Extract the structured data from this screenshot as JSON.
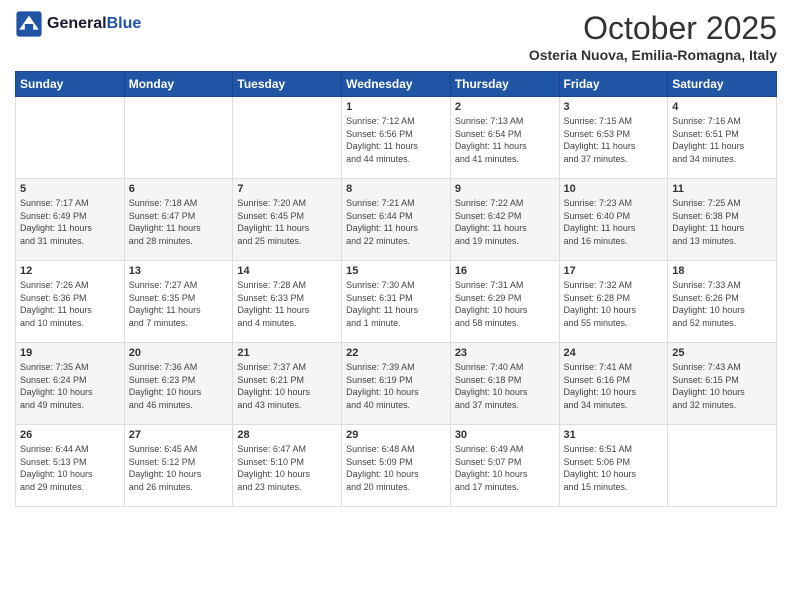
{
  "header": {
    "logo_line1": "General",
    "logo_line2": "Blue",
    "title": "October 2025",
    "subtitle": "Osteria Nuova, Emilia-Romagna, Italy"
  },
  "days_of_week": [
    "Sunday",
    "Monday",
    "Tuesday",
    "Wednesday",
    "Thursday",
    "Friday",
    "Saturday"
  ],
  "weeks": [
    [
      {
        "day": "",
        "info": ""
      },
      {
        "day": "",
        "info": ""
      },
      {
        "day": "",
        "info": ""
      },
      {
        "day": "1",
        "info": "Sunrise: 7:12 AM\nSunset: 6:56 PM\nDaylight: 11 hours\nand 44 minutes."
      },
      {
        "day": "2",
        "info": "Sunrise: 7:13 AM\nSunset: 6:54 PM\nDaylight: 11 hours\nand 41 minutes."
      },
      {
        "day": "3",
        "info": "Sunrise: 7:15 AM\nSunset: 6:53 PM\nDaylight: 11 hours\nand 37 minutes."
      },
      {
        "day": "4",
        "info": "Sunrise: 7:16 AM\nSunset: 6:51 PM\nDaylight: 11 hours\nand 34 minutes."
      }
    ],
    [
      {
        "day": "5",
        "info": "Sunrise: 7:17 AM\nSunset: 6:49 PM\nDaylight: 11 hours\nand 31 minutes."
      },
      {
        "day": "6",
        "info": "Sunrise: 7:18 AM\nSunset: 6:47 PM\nDaylight: 11 hours\nand 28 minutes."
      },
      {
        "day": "7",
        "info": "Sunrise: 7:20 AM\nSunset: 6:45 PM\nDaylight: 11 hours\nand 25 minutes."
      },
      {
        "day": "8",
        "info": "Sunrise: 7:21 AM\nSunset: 6:44 PM\nDaylight: 11 hours\nand 22 minutes."
      },
      {
        "day": "9",
        "info": "Sunrise: 7:22 AM\nSunset: 6:42 PM\nDaylight: 11 hours\nand 19 minutes."
      },
      {
        "day": "10",
        "info": "Sunrise: 7:23 AM\nSunset: 6:40 PM\nDaylight: 11 hours\nand 16 minutes."
      },
      {
        "day": "11",
        "info": "Sunrise: 7:25 AM\nSunset: 6:38 PM\nDaylight: 11 hours\nand 13 minutes."
      }
    ],
    [
      {
        "day": "12",
        "info": "Sunrise: 7:26 AM\nSunset: 6:36 PM\nDaylight: 11 hours\nand 10 minutes."
      },
      {
        "day": "13",
        "info": "Sunrise: 7:27 AM\nSunset: 6:35 PM\nDaylight: 11 hours\nand 7 minutes."
      },
      {
        "day": "14",
        "info": "Sunrise: 7:28 AM\nSunset: 6:33 PM\nDaylight: 11 hours\nand 4 minutes."
      },
      {
        "day": "15",
        "info": "Sunrise: 7:30 AM\nSunset: 6:31 PM\nDaylight: 11 hours\nand 1 minute."
      },
      {
        "day": "16",
        "info": "Sunrise: 7:31 AM\nSunset: 6:29 PM\nDaylight: 10 hours\nand 58 minutes."
      },
      {
        "day": "17",
        "info": "Sunrise: 7:32 AM\nSunset: 6:28 PM\nDaylight: 10 hours\nand 55 minutes."
      },
      {
        "day": "18",
        "info": "Sunrise: 7:33 AM\nSunset: 6:26 PM\nDaylight: 10 hours\nand 52 minutes."
      }
    ],
    [
      {
        "day": "19",
        "info": "Sunrise: 7:35 AM\nSunset: 6:24 PM\nDaylight: 10 hours\nand 49 minutes."
      },
      {
        "day": "20",
        "info": "Sunrise: 7:36 AM\nSunset: 6:23 PM\nDaylight: 10 hours\nand 46 minutes."
      },
      {
        "day": "21",
        "info": "Sunrise: 7:37 AM\nSunset: 6:21 PM\nDaylight: 10 hours\nand 43 minutes."
      },
      {
        "day": "22",
        "info": "Sunrise: 7:39 AM\nSunset: 6:19 PM\nDaylight: 10 hours\nand 40 minutes."
      },
      {
        "day": "23",
        "info": "Sunrise: 7:40 AM\nSunset: 6:18 PM\nDaylight: 10 hours\nand 37 minutes."
      },
      {
        "day": "24",
        "info": "Sunrise: 7:41 AM\nSunset: 6:16 PM\nDaylight: 10 hours\nand 34 minutes."
      },
      {
        "day": "25",
        "info": "Sunrise: 7:43 AM\nSunset: 6:15 PM\nDaylight: 10 hours\nand 32 minutes."
      }
    ],
    [
      {
        "day": "26",
        "info": "Sunrise: 6:44 AM\nSunset: 5:13 PM\nDaylight: 10 hours\nand 29 minutes."
      },
      {
        "day": "27",
        "info": "Sunrise: 6:45 AM\nSunset: 5:12 PM\nDaylight: 10 hours\nand 26 minutes."
      },
      {
        "day": "28",
        "info": "Sunrise: 6:47 AM\nSunset: 5:10 PM\nDaylight: 10 hours\nand 23 minutes."
      },
      {
        "day": "29",
        "info": "Sunrise: 6:48 AM\nSunset: 5:09 PM\nDaylight: 10 hours\nand 20 minutes."
      },
      {
        "day": "30",
        "info": "Sunrise: 6:49 AM\nSunset: 5:07 PM\nDaylight: 10 hours\nand 17 minutes."
      },
      {
        "day": "31",
        "info": "Sunrise: 6:51 AM\nSunset: 5:06 PM\nDaylight: 10 hours\nand 15 minutes."
      },
      {
        "day": "",
        "info": ""
      }
    ]
  ]
}
